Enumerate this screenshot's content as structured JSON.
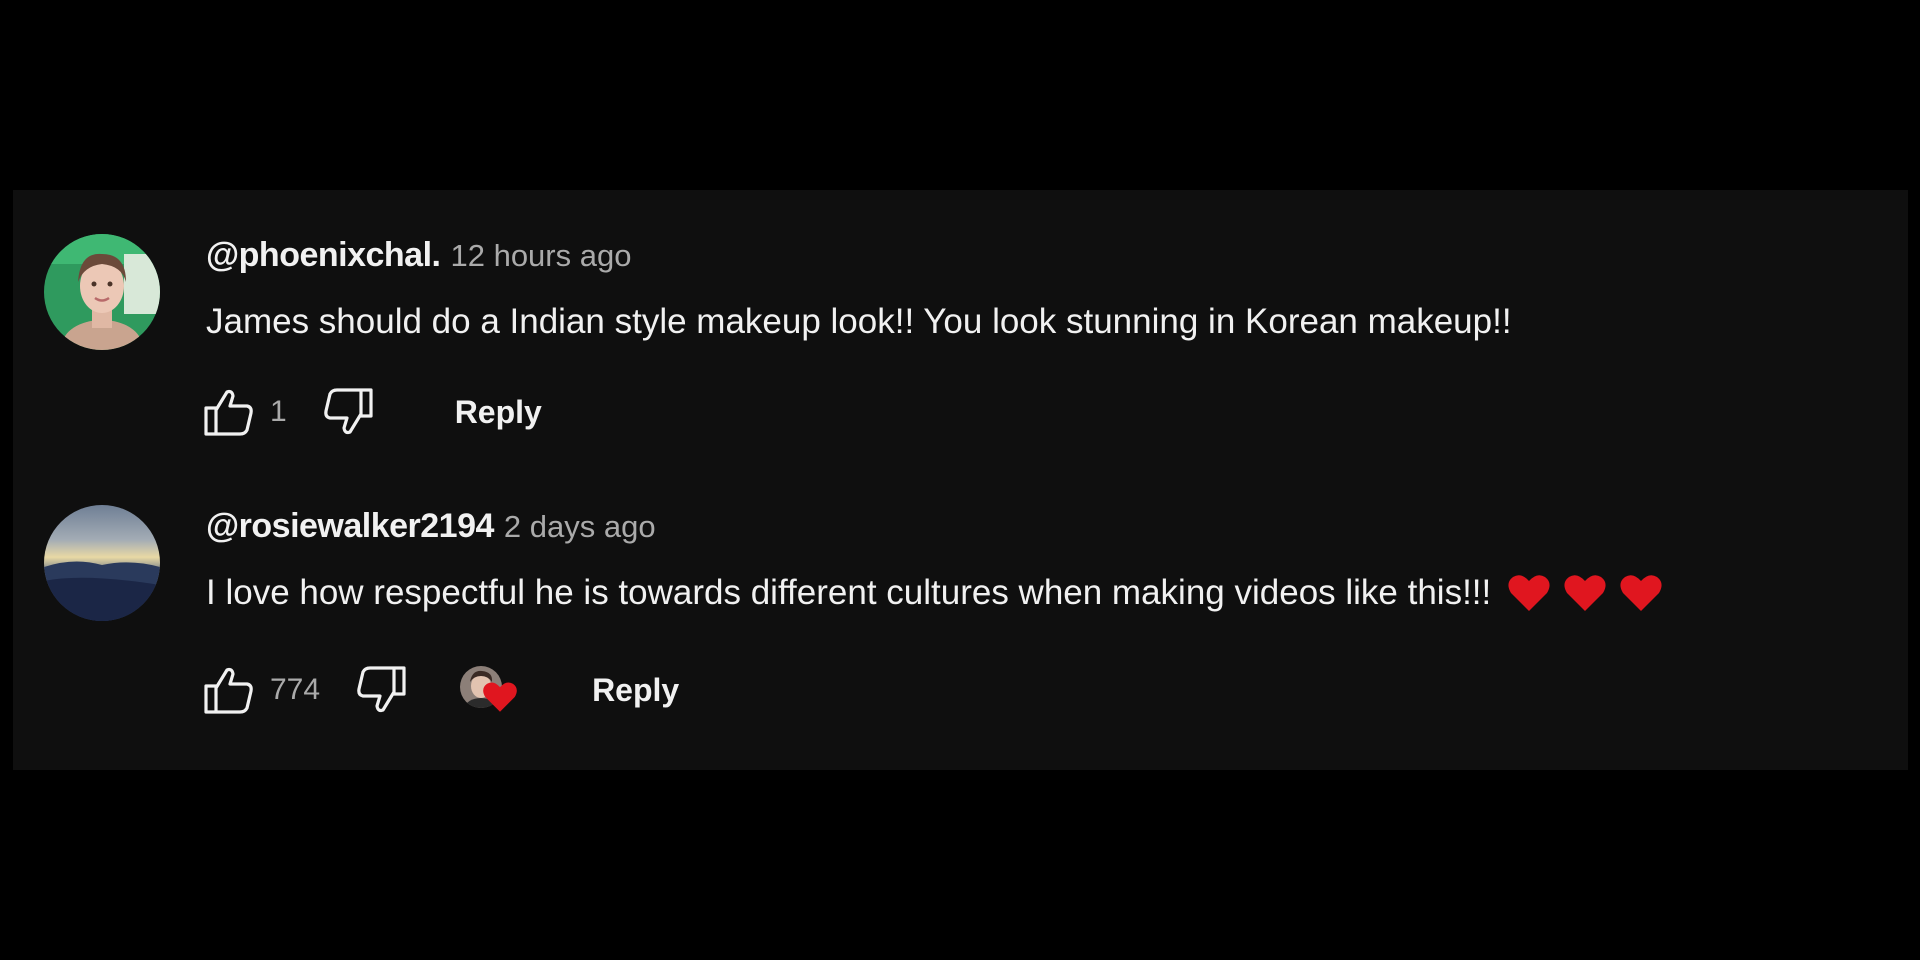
{
  "comments": [
    {
      "author": "@phoenixchal.",
      "time": "12 hours ago",
      "text": "James should do a Indian style makeup look!! You look stunning in Korean makeup!!",
      "likes": "1",
      "reply_label": "Reply",
      "avatar": "woman-portrait-green-background",
      "creator_heart": false
    },
    {
      "author": "@rosiewalker2194",
      "time": "2 days ago",
      "text": "I love how respectful he is towards different cultures when making videos like this!!!",
      "emoji_hearts": 3,
      "likes": "774",
      "reply_label": "Reply",
      "avatar": "sunset-landscape",
      "creator_heart": true
    }
  ],
  "icons": {
    "like": "thumbs-up-icon",
    "dislike": "thumbs-down-icon",
    "heart": "red-heart-icon"
  },
  "colors": {
    "background": "#000000",
    "panel": "#0f0f0f",
    "primary_text": "#f1f1f1",
    "secondary_text": "#aaaaaa",
    "heart": "#e0161f"
  }
}
